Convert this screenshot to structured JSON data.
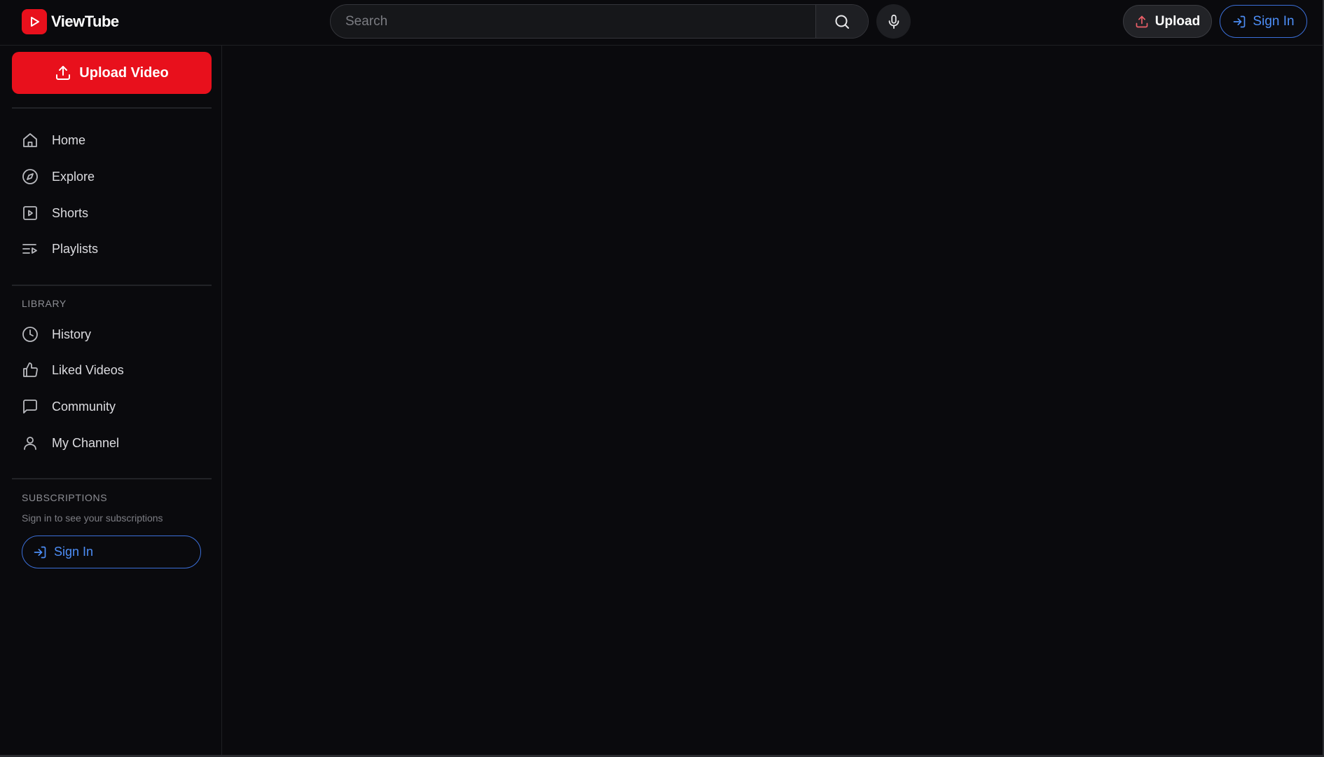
{
  "app": {
    "name": "ViewTube"
  },
  "header": {
    "search_placeholder": "Search",
    "upload_label": "Upload",
    "signin_label": "Sign In"
  },
  "sidebar": {
    "upload_video_label": "Upload Video",
    "main_nav": [
      {
        "label": "Home",
        "icon": "home-icon"
      },
      {
        "label": "Explore",
        "icon": "compass-icon"
      },
      {
        "label": "Shorts",
        "icon": "shorts-icon"
      },
      {
        "label": "Playlists",
        "icon": "playlist-icon"
      }
    ],
    "library_title": "LIBRARY",
    "library_nav": [
      {
        "label": "History",
        "icon": "clock-icon"
      },
      {
        "label": "Liked Videos",
        "icon": "thumbs-up-icon"
      },
      {
        "label": "Community",
        "icon": "message-icon"
      },
      {
        "label": "My Channel",
        "icon": "user-icon"
      }
    ],
    "subscriptions_title": "SUBSCRIPTIONS",
    "subscriptions_hint": "Sign in to see your subscriptions",
    "signin_label": "Sign In"
  },
  "colors": {
    "background": "#0a0a0d",
    "brand_red": "#e8101c",
    "link_blue": "#4d8ef7"
  }
}
